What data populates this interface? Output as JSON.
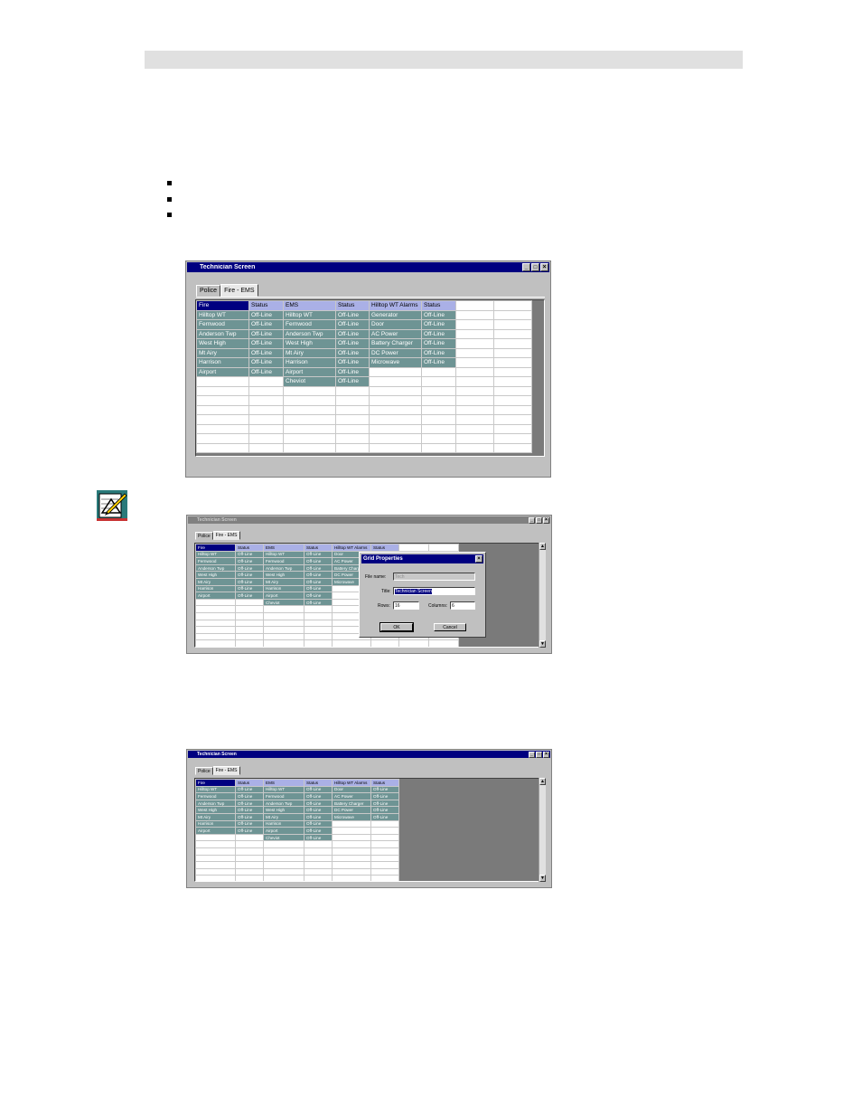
{
  "window_title": "Technician Screen",
  "tabs": [
    "Police",
    "Fire - EMS"
  ],
  "grid": {
    "headers": [
      "Fire",
      "Status",
      "EMS",
      "Status",
      "Hilltop WT Alarms",
      "Status"
    ],
    "rows": [
      [
        "Hilltop WT",
        "Off-Line",
        "Hilltop WT",
        "Off-Line",
        "Generator",
        "Off-Line"
      ],
      [
        "Fernwood",
        "Off-Line",
        "Fernwood",
        "Off-Line",
        "Door",
        "Off-Line"
      ],
      [
        "Anderson Twp",
        "Off-Line",
        "Anderson Twp",
        "Off-Line",
        "AC Power",
        "Off-Line"
      ],
      [
        "West High",
        "Off-Line",
        "West High",
        "Off-Line",
        "Battery Charger",
        "Off-Line"
      ],
      [
        "Mt Airy",
        "Off-Line",
        "Mt Airy",
        "Off-Line",
        "DC Power",
        "Off-Line"
      ],
      [
        "Harrison",
        "Off-Line",
        "Harrison",
        "Off-Line",
        "Microwave",
        "Off-Line"
      ],
      [
        "Airport",
        "Off-Line",
        "Airport",
        "Off-Line",
        "",
        ""
      ],
      [
        "",
        "",
        "Cheviot",
        "Off-Line",
        "",
        ""
      ]
    ],
    "rows_3": [
      [
        "Hilltop WT",
        "Off-Line",
        "Hilltop WT",
        "Off-Line",
        "Door",
        "Off-Line"
      ],
      [
        "Fernwood",
        "Off-Line",
        "Fernwood",
        "Off-Line",
        "AC Power",
        "Off-Line"
      ],
      [
        "Anderson Twp",
        "Off-Line",
        "Anderson Twp",
        "Off-Line",
        "Battery Charger",
        "Off-Line"
      ],
      [
        "West High",
        "Off-Line",
        "West High",
        "Off-Line",
        "DC Power",
        "Off-Line"
      ],
      [
        "Mt Airy",
        "Off-Line",
        "Mt Airy",
        "Off-Line",
        "Microwave",
        "Off-Line"
      ],
      [
        "Harrison",
        "Off-Line",
        "Harrison",
        "Off-Line",
        "",
        ""
      ],
      [
        "Airport",
        "Off-Line",
        "Airport",
        "Off-Line",
        "",
        ""
      ],
      [
        "",
        "",
        "Cheviot",
        "Off-Line",
        "",
        ""
      ]
    ],
    "rows_2_alarms": [
      "Door",
      "AC Power",
      "Battery Charger",
      "DC Power",
      "Microwave"
    ]
  },
  "dialog": {
    "title": "Grid Properties",
    "file_name_label": "File name:",
    "file_name_value": "Tech",
    "title_label": "Title:",
    "title_value": "Technician Screen",
    "rows_label": "Rows:",
    "rows_value": "16",
    "columns_label": "Columns:",
    "columns_value": "6",
    "ok_label": "OK",
    "cancel_label": "Cancel"
  },
  "icons": {
    "side_icon": "grid-properties-edit-icon",
    "minimize": "minimize-icon",
    "maximize": "maximize-icon",
    "close": "close-icon"
  },
  "colors": {
    "titlebar": "#000080",
    "data_cell": "#6e9494",
    "header_cell": "#aab0e6",
    "window_bg": "#c0c0c0"
  }
}
